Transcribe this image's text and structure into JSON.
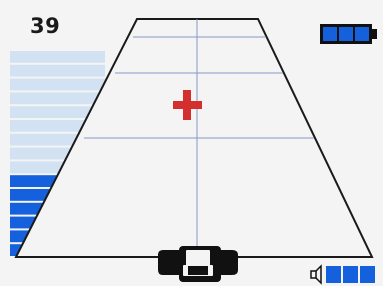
{
  "hud": {
    "count": "39"
  },
  "battery": {
    "level_segments": 3,
    "total_segments": 3
  },
  "depth_gauge": {
    "filled_segments": 6,
    "total_segments": 15
  },
  "volume": {
    "level_segments": 3,
    "total_segments": 3
  },
  "colors": {
    "accent": "#1560dd",
    "accent_faint": "#d3e2f3",
    "target": "#d32f2f",
    "grid": "#8898c8",
    "outline": "#1a1a1a",
    "device": "#111111"
  },
  "icons": {
    "battery": "battery-icon",
    "speaker": "speaker-icon",
    "target": "crosshair-plus-icon",
    "device": "detector-coil-icon"
  }
}
